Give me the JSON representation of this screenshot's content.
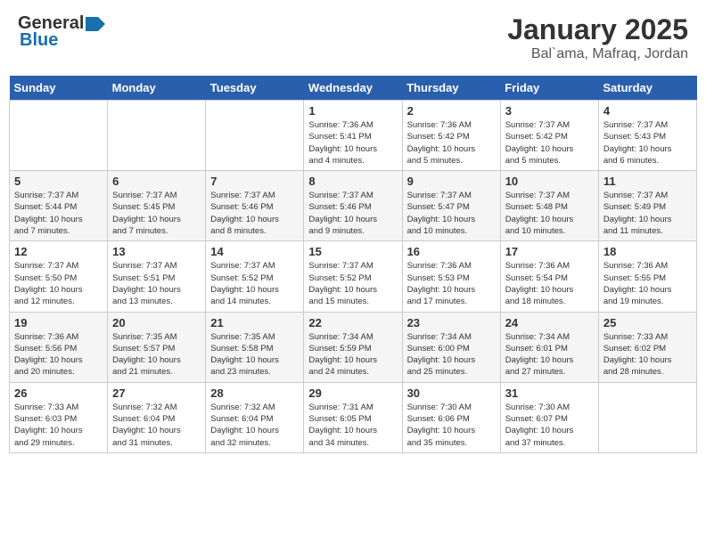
{
  "logo": {
    "general": "General",
    "blue": "Blue"
  },
  "title": "January 2025",
  "location": "Bal`ama, Mafraq, Jordan",
  "days_header": [
    "Sunday",
    "Monday",
    "Tuesday",
    "Wednesday",
    "Thursday",
    "Friday",
    "Saturday"
  ],
  "weeks": [
    [
      {
        "day": "",
        "info": ""
      },
      {
        "day": "",
        "info": ""
      },
      {
        "day": "",
        "info": ""
      },
      {
        "day": "1",
        "info": "Sunrise: 7:36 AM\nSunset: 5:41 PM\nDaylight: 10 hours\nand 4 minutes."
      },
      {
        "day": "2",
        "info": "Sunrise: 7:36 AM\nSunset: 5:42 PM\nDaylight: 10 hours\nand 5 minutes."
      },
      {
        "day": "3",
        "info": "Sunrise: 7:37 AM\nSunset: 5:42 PM\nDaylight: 10 hours\nand 5 minutes."
      },
      {
        "day": "4",
        "info": "Sunrise: 7:37 AM\nSunset: 5:43 PM\nDaylight: 10 hours\nand 6 minutes."
      }
    ],
    [
      {
        "day": "5",
        "info": "Sunrise: 7:37 AM\nSunset: 5:44 PM\nDaylight: 10 hours\nand 7 minutes."
      },
      {
        "day": "6",
        "info": "Sunrise: 7:37 AM\nSunset: 5:45 PM\nDaylight: 10 hours\nand 7 minutes."
      },
      {
        "day": "7",
        "info": "Sunrise: 7:37 AM\nSunset: 5:46 PM\nDaylight: 10 hours\nand 8 minutes."
      },
      {
        "day": "8",
        "info": "Sunrise: 7:37 AM\nSunset: 5:46 PM\nDaylight: 10 hours\nand 9 minutes."
      },
      {
        "day": "9",
        "info": "Sunrise: 7:37 AM\nSunset: 5:47 PM\nDaylight: 10 hours\nand 10 minutes."
      },
      {
        "day": "10",
        "info": "Sunrise: 7:37 AM\nSunset: 5:48 PM\nDaylight: 10 hours\nand 10 minutes."
      },
      {
        "day": "11",
        "info": "Sunrise: 7:37 AM\nSunset: 5:49 PM\nDaylight: 10 hours\nand 11 minutes."
      }
    ],
    [
      {
        "day": "12",
        "info": "Sunrise: 7:37 AM\nSunset: 5:50 PM\nDaylight: 10 hours\nand 12 minutes."
      },
      {
        "day": "13",
        "info": "Sunrise: 7:37 AM\nSunset: 5:51 PM\nDaylight: 10 hours\nand 13 minutes."
      },
      {
        "day": "14",
        "info": "Sunrise: 7:37 AM\nSunset: 5:52 PM\nDaylight: 10 hours\nand 14 minutes."
      },
      {
        "day": "15",
        "info": "Sunrise: 7:37 AM\nSunset: 5:52 PM\nDaylight: 10 hours\nand 15 minutes."
      },
      {
        "day": "16",
        "info": "Sunrise: 7:36 AM\nSunset: 5:53 PM\nDaylight: 10 hours\nand 17 minutes."
      },
      {
        "day": "17",
        "info": "Sunrise: 7:36 AM\nSunset: 5:54 PM\nDaylight: 10 hours\nand 18 minutes."
      },
      {
        "day": "18",
        "info": "Sunrise: 7:36 AM\nSunset: 5:55 PM\nDaylight: 10 hours\nand 19 minutes."
      }
    ],
    [
      {
        "day": "19",
        "info": "Sunrise: 7:36 AM\nSunset: 5:56 PM\nDaylight: 10 hours\nand 20 minutes."
      },
      {
        "day": "20",
        "info": "Sunrise: 7:35 AM\nSunset: 5:57 PM\nDaylight: 10 hours\nand 21 minutes."
      },
      {
        "day": "21",
        "info": "Sunrise: 7:35 AM\nSunset: 5:58 PM\nDaylight: 10 hours\nand 23 minutes."
      },
      {
        "day": "22",
        "info": "Sunrise: 7:34 AM\nSunset: 5:59 PM\nDaylight: 10 hours\nand 24 minutes."
      },
      {
        "day": "23",
        "info": "Sunrise: 7:34 AM\nSunset: 6:00 PM\nDaylight: 10 hours\nand 25 minutes."
      },
      {
        "day": "24",
        "info": "Sunrise: 7:34 AM\nSunset: 6:01 PM\nDaylight: 10 hours\nand 27 minutes."
      },
      {
        "day": "25",
        "info": "Sunrise: 7:33 AM\nSunset: 6:02 PM\nDaylight: 10 hours\nand 28 minutes."
      }
    ],
    [
      {
        "day": "26",
        "info": "Sunrise: 7:33 AM\nSunset: 6:03 PM\nDaylight: 10 hours\nand 29 minutes."
      },
      {
        "day": "27",
        "info": "Sunrise: 7:32 AM\nSunset: 6:04 PM\nDaylight: 10 hours\nand 31 minutes."
      },
      {
        "day": "28",
        "info": "Sunrise: 7:32 AM\nSunset: 6:04 PM\nDaylight: 10 hours\nand 32 minutes."
      },
      {
        "day": "29",
        "info": "Sunrise: 7:31 AM\nSunset: 6:05 PM\nDaylight: 10 hours\nand 34 minutes."
      },
      {
        "day": "30",
        "info": "Sunrise: 7:30 AM\nSunset: 6:06 PM\nDaylight: 10 hours\nand 35 minutes."
      },
      {
        "day": "31",
        "info": "Sunrise: 7:30 AM\nSunset: 6:07 PM\nDaylight: 10 hours\nand 37 minutes."
      },
      {
        "day": "",
        "info": ""
      }
    ]
  ]
}
